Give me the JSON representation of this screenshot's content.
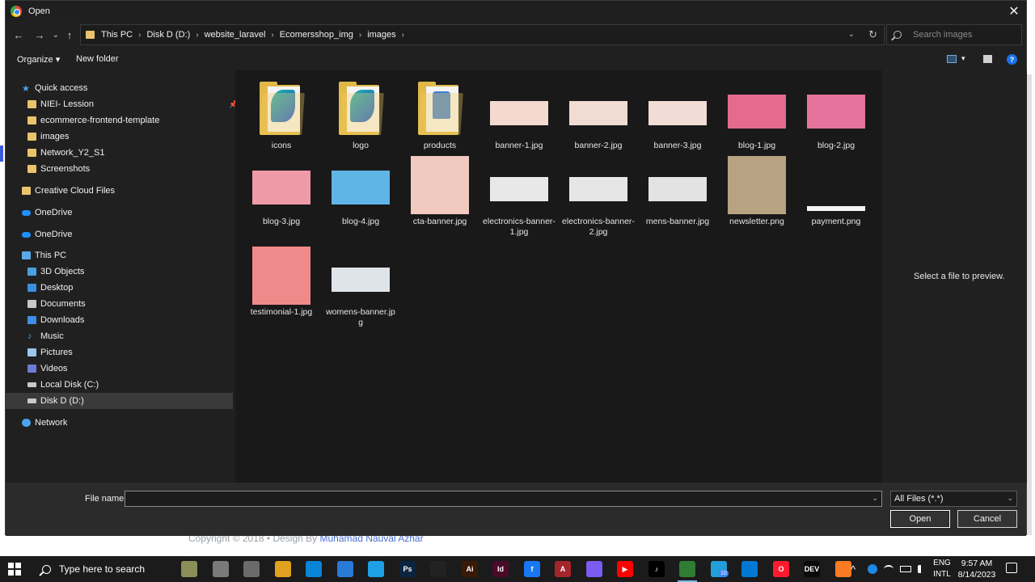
{
  "background": {
    "footer_text": "Copyright © 2018",
    "footer_sep": "•",
    "footer_design": "Design By",
    "footer_author": "Muhamad Nauval Azhar"
  },
  "dialog": {
    "title": "Open",
    "close_glyph": "✕"
  },
  "nav": {
    "back_glyph": "←",
    "forward_glyph": "→",
    "recent_glyph": "⌄",
    "up_glyph": "↑",
    "breadcrumbs": [
      "This PC",
      "Disk D (D:)",
      "website_laravel",
      "Ecomersshop_img",
      "images"
    ],
    "crumb_sep": "›",
    "dropdown_glyph": "⌄",
    "refresh_glyph": "↻",
    "search_placeholder": "Search images"
  },
  "toolbar": {
    "organize": "Organize ▾",
    "new_folder": "New folder",
    "view_dropdown": "▾",
    "help": "?"
  },
  "sidebar": {
    "quick_access": "Quick access",
    "quick_items": [
      "NIEI- Lession",
      "ecommerce-frontend-template",
      "images",
      "Network_Y2_S1",
      "Screenshots"
    ],
    "pin_glyph": "📌",
    "creative_cloud": "Creative Cloud Files",
    "onedrive_1": "OneDrive",
    "onedrive_2": "OneDrive",
    "this_pc": "This PC",
    "pc_items": [
      "3D Objects",
      "Desktop",
      "Documents",
      "Downloads",
      "Music",
      "Pictures",
      "Videos",
      "Local Disk (C:)",
      "Disk D (D:)"
    ],
    "network": "Network",
    "star_glyph": "★",
    "music_glyph": "♪"
  },
  "files": [
    {
      "name": "icons",
      "kind": "folder-logo"
    },
    {
      "name": "logo",
      "kind": "folder-logo"
    },
    {
      "name": "products",
      "kind": "folder-shirt"
    },
    {
      "name": "banner-1.jpg",
      "kind": "banner",
      "color": "#f3d9cf"
    },
    {
      "name": "banner-2.jpg",
      "kind": "banner",
      "color": "#f1dcd3"
    },
    {
      "name": "banner-3.jpg",
      "kind": "banner",
      "color": "#f2dcd6"
    },
    {
      "name": "blog-1.jpg",
      "kind": "photo",
      "color": "#e56b8e"
    },
    {
      "name": "blog-2.jpg",
      "kind": "photo",
      "color": "#e5739b"
    },
    {
      "name": "blog-3.jpg",
      "kind": "photo",
      "color": "#ef9aa7"
    },
    {
      "name": "blog-4.jpg",
      "kind": "photo",
      "color": "#5fb5e6"
    },
    {
      "name": "cta-banner.jpg",
      "kind": "square",
      "color": "#f0c9bf"
    },
    {
      "name": "electronics-banner-1.jpg",
      "kind": "banner",
      "color": "#e8e8e8"
    },
    {
      "name": "electronics-banner-2.jpg",
      "kind": "banner",
      "color": "#e6e6e6"
    },
    {
      "name": "mens-banner.jpg",
      "kind": "banner",
      "color": "#e3e3e3"
    },
    {
      "name": "newsletter.png",
      "kind": "tall",
      "color": "#b7a382"
    },
    {
      "name": "payment.png",
      "kind": "strip",
      "color": "#f5f5f5"
    },
    {
      "name": "testimonial-1.jpg",
      "kind": "square",
      "color": "#f08a8a"
    },
    {
      "name": "womens-banner.jpg",
      "kind": "banner",
      "color": "#dfe4ea"
    }
  ],
  "preview": {
    "text": "Select a file to preview."
  },
  "bottom": {
    "file_name_label": "File name:",
    "file_name_value": "",
    "dropdown_glyph": "⌄",
    "filter": "All Files (*.*)",
    "open": "Open",
    "cancel": "Cancel"
  },
  "taskbar": {
    "search_placeholder": "Type here to search",
    "apps": [
      {
        "label": "",
        "color": "#8a8f5a"
      },
      {
        "label": "",
        "color": "#7a7a7a"
      },
      {
        "label": "",
        "color": "#6b6b6b"
      },
      {
        "label": "",
        "color": "#e0a020"
      },
      {
        "label": "",
        "color": "#0a84d6"
      },
      {
        "label": "",
        "color": "#2a7ad8"
      },
      {
        "label": "",
        "color": "#1ea0e6"
      },
      {
        "label": "Ps",
        "color": "#0b2540"
      },
      {
        "label": "",
        "color": "#222222"
      },
      {
        "label": "Ai",
        "color": "#3a1a05"
      },
      {
        "label": "Id",
        "color": "#4a0a2a"
      },
      {
        "label": "f",
        "color": "#1877f2"
      },
      {
        "label": "A",
        "color": "#a4262c"
      },
      {
        "label": "",
        "color": "#7b5cf0"
      },
      {
        "label": "▶",
        "color": "#ff0000"
      },
      {
        "label": "♪",
        "color": "#000000"
      },
      {
        "label": "",
        "color": "#2f7d32"
      },
      {
        "label": "",
        "color": "#229ed9"
      },
      {
        "label": "",
        "color": "#0078d4"
      },
      {
        "label": "O",
        "color": "#ff1b2d"
      },
      {
        "label": "DEV",
        "color": "#0a0a0a"
      },
      {
        "label": "",
        "color": "#fb7a24"
      }
    ],
    "telegram_badge": "10",
    "tray_up_glyph": "^",
    "lang_1": "ENG",
    "lang_2": "INTL",
    "time": "9:57 AM",
    "date": "8/14/2023"
  }
}
